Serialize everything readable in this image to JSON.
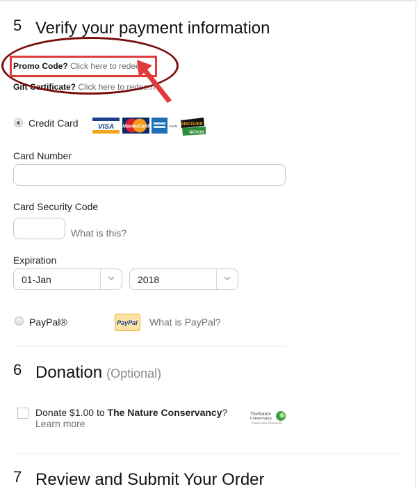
{
  "section5": {
    "number": "5",
    "title": "Verify your payment information",
    "promo": {
      "label": "Promo Code?",
      "link": "Click here to redeem"
    },
    "gift": {
      "label": "Gift Certificate?",
      "link": "Click here to redeem"
    },
    "credit_card": {
      "label": "Credit Card",
      "selected": true,
      "card_logos": [
        "VISA",
        "MasterCard",
        "American Express",
        "Discover Novus"
      ]
    },
    "card_number": {
      "label": "Card Number",
      "value": ""
    },
    "security_code": {
      "label": "Card Security Code",
      "value": "",
      "help": "What is this?"
    },
    "expiration": {
      "label": "Expiration",
      "month": "01-Jan",
      "year": "2018"
    },
    "paypal": {
      "label": "PayPal®",
      "selected": false,
      "logo_text": "PayPal",
      "help": "What is PayPal?"
    }
  },
  "section6": {
    "number": "6",
    "title": "Donation",
    "optional": "(Optional)",
    "donate_prefix": "Donate $1.00 to ",
    "donate_org": "The Nature Conservancy",
    "donate_suffix": "?",
    "learn_more": "Learn more",
    "checked": false,
    "org_logo_text": "The Nature Conservancy"
  },
  "section7": {
    "number": "7",
    "title": "Review and Submit Your Order"
  },
  "colors": {
    "annotation_ellipse": "#7a0d0d",
    "annotation_box": "#e2393a"
  }
}
